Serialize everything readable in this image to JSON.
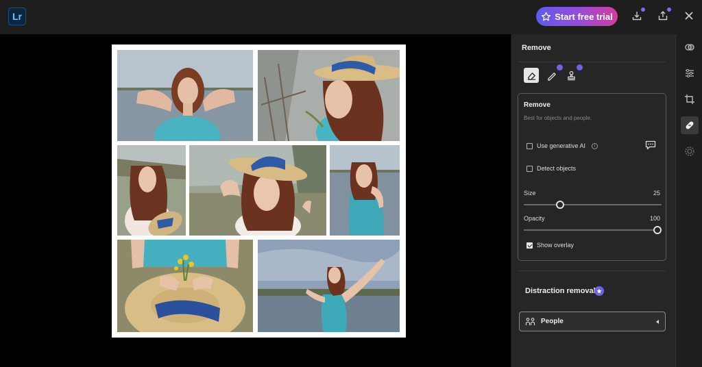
{
  "app": {
    "logo_text": "Lr"
  },
  "header": {
    "trial_label": "Start free trial",
    "accent": "#6f57f0"
  },
  "panel": {
    "title": "Remove",
    "card": {
      "title": "Remove",
      "description": "Best for objects and people.",
      "use_generative_ai": "Use generative AI",
      "detect_objects": "Detect objects",
      "size_label": "Size",
      "size_value": "25",
      "opacity_label": "Opacity",
      "opacity_value": "100",
      "show_overlay": "Show overlay"
    },
    "distraction_title": "Distraction removal",
    "people_label": "People"
  },
  "sliders": {
    "size_fraction": 0.25,
    "opacity_fraction": 1.0
  },
  "icons": {
    "top": [
      "lightroom-logo",
      "star-icon",
      "export-icon",
      "share-icon",
      "close-icon"
    ],
    "tools": [
      "eraser-icon",
      "heal-brush-icon",
      "clone-stamp-icon"
    ],
    "rail": [
      "presets-icon",
      "adjust-sliders-icon",
      "crop-icon",
      "heal-icon",
      "masking-icon"
    ]
  }
}
